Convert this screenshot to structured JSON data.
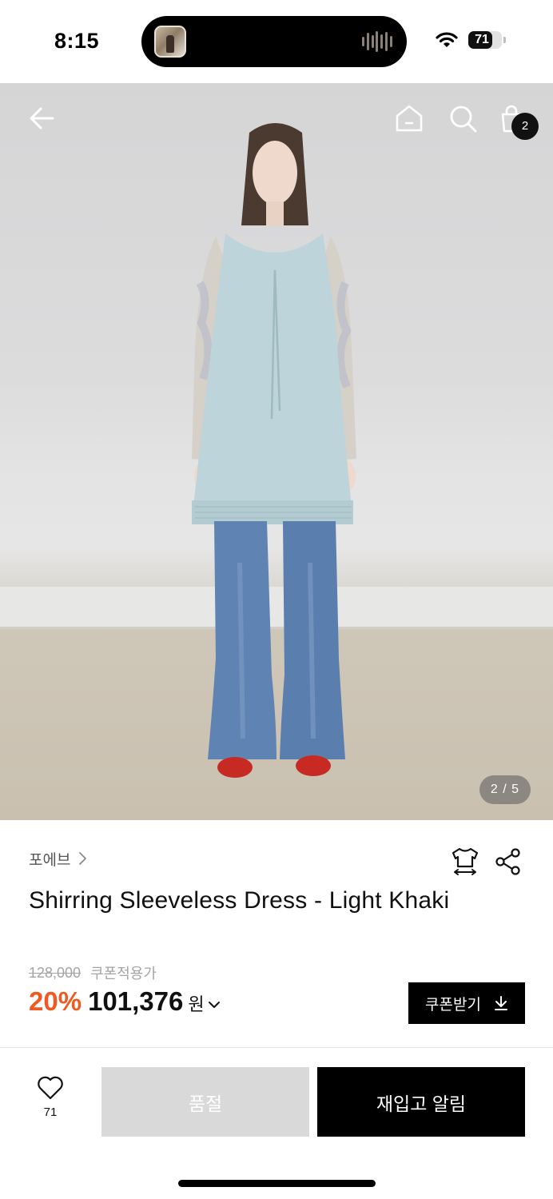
{
  "status_bar": {
    "time": "8:15",
    "battery_level": "71",
    "battery_fraction": 0.71,
    "icons": [
      "wifi-icon",
      "battery-icon"
    ],
    "island_activity": "now-playing-thumbnail"
  },
  "product_gallery": {
    "page_indicator": "2 / 5",
    "current_page": 2,
    "total_pages": 5,
    "nav_icons": [
      "back-arrow-icon",
      "home-icon",
      "search-icon",
      "shopping-bag-icon"
    ],
    "cart_count": "2"
  },
  "product": {
    "brand": "포에브",
    "title": "Shirring Sleeveless Dress - Light Khaki",
    "original_price": "128,000",
    "coupon_label": "쿠폰적용가",
    "discount_rate": "20%",
    "sale_price": "101,376",
    "currency": "원",
    "coupon_button_label": "쿠폰받기",
    "action_icons": [
      "size-fit-icon",
      "share-icon"
    ]
  },
  "bottom_bar": {
    "like_count": "71",
    "soldout_label": "품절",
    "restock_label": "재입고 알림"
  },
  "colors": {
    "accent_discount": "#f05a22",
    "primary_button": "#000000",
    "disabled_button": "#d9d9d9",
    "muted_text": "#a4a4a4"
  }
}
